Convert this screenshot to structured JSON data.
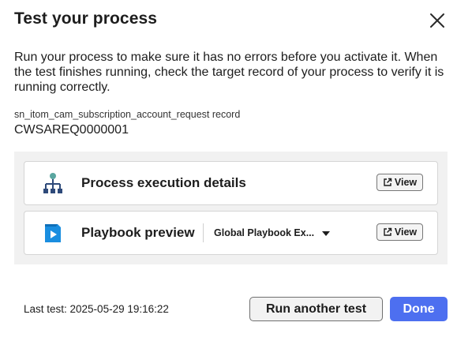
{
  "dialog": {
    "title": "Test your process",
    "close_label": "close",
    "description": "Run your process to make sure it has no errors before you activate it. When the test finishes running, check the target record of your process to verify it is running correctly.",
    "record_label": "sn_itom_cam_subscription_account_request record",
    "record_value": "CWSAREQ0000001"
  },
  "cards": {
    "process_execution": {
      "title": "Process execution details",
      "icon": "hierarchy-icon",
      "view_label": "View"
    },
    "playbook_preview": {
      "title": "Playbook preview",
      "icon": "playbook-icon",
      "dropdown_value": "Global Playbook Ex...",
      "view_label": "View"
    }
  },
  "footer": {
    "last_test": "Last test: 2025-05-29 19:16:22",
    "run_again_label": "Run another test",
    "done_label": "Done"
  },
  "colors": {
    "primary": "#4d6ff0",
    "panel_bg": "#f1f1f1",
    "hierarchy_top": "#5aa6a0",
    "hierarchy_nodes": "#2e4a7a",
    "playbook_blue": "#1a8ee0"
  }
}
